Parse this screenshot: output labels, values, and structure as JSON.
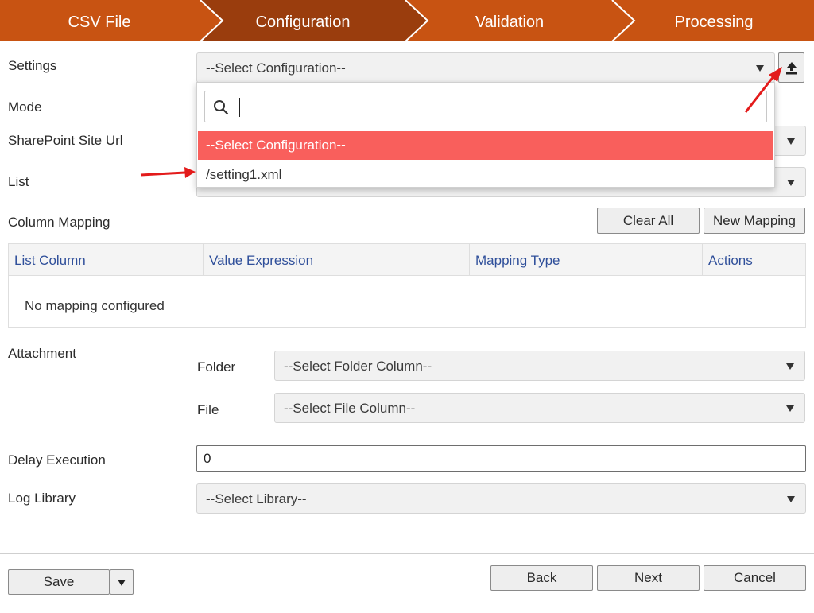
{
  "wizard": {
    "steps": [
      {
        "label": "CSV File",
        "state": "done"
      },
      {
        "label": "Configuration",
        "state": "active"
      },
      {
        "label": "Validation",
        "state": "pending"
      },
      {
        "label": "Processing",
        "state": "pending"
      }
    ]
  },
  "form": {
    "settings": {
      "label": "Settings",
      "value": "--Select Configuration--"
    },
    "mode": {
      "label": "Mode"
    },
    "site_url": {
      "label": "SharePoint Site Url"
    },
    "list": {
      "label": "List"
    },
    "column_mapping": {
      "label": "Column Mapping",
      "clear_all": "Clear All",
      "new_mapping": "New Mapping",
      "headers": [
        "List Column",
        "Value Expression",
        "Mapping Type",
        "Actions"
      ],
      "empty_text": "No mapping configured"
    },
    "attachment": {
      "label": "Attachment",
      "folder_label": "Folder",
      "folder_value": "--Select Folder Column--",
      "file_label": "File",
      "file_value": "--Select File Column--"
    },
    "delay": {
      "label": "Delay Execution",
      "value": "0"
    },
    "log_library": {
      "label": "Log Library",
      "value": "--Select Library--"
    }
  },
  "dropdown": {
    "search_value": "",
    "options": [
      "--Select Configuration--",
      "/setting1.xml"
    ],
    "highlighted_index": 0
  },
  "footer": {
    "save": "Save",
    "back": "Back",
    "next": "Next",
    "cancel": "Cancel"
  },
  "colors": {
    "step_done": "#c85312",
    "step_active": "#9a3d0d",
    "highlight": "#f95f5c",
    "annotation_arrow": "#e31b1b",
    "header_text": "#2f4f9a"
  },
  "icons": {
    "upload": "upload-icon",
    "search": "search-icon",
    "caret": "caret-down-icon"
  }
}
